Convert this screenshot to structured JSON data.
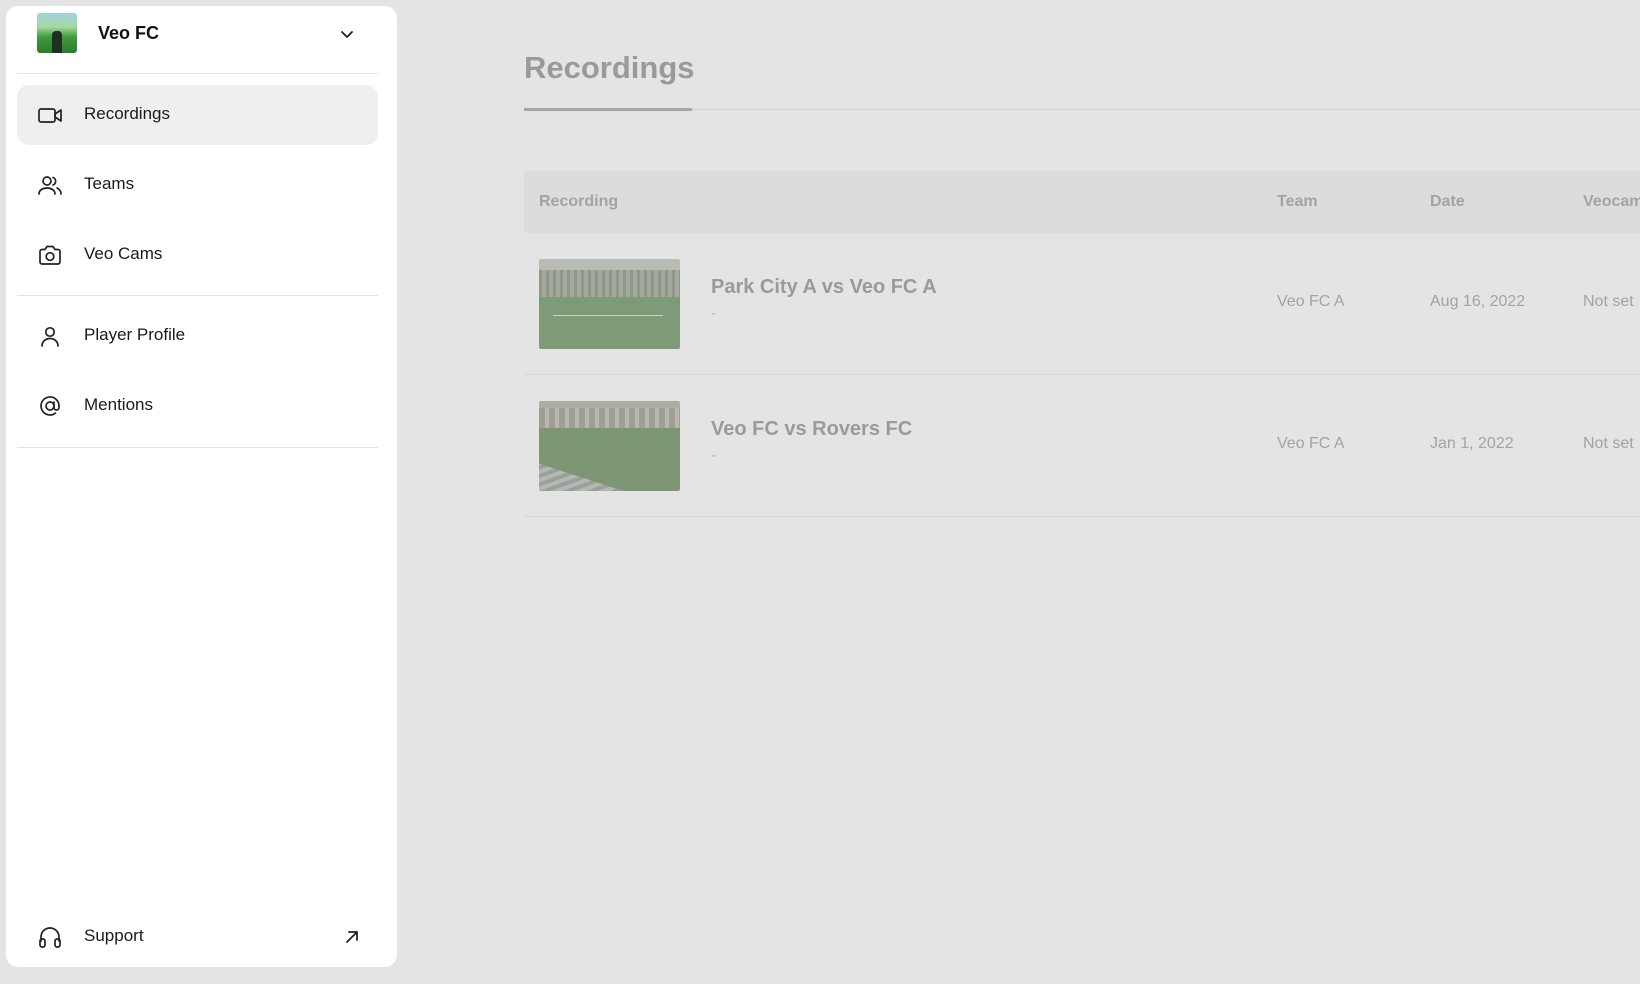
{
  "sidebar": {
    "club_name": "Veo FC",
    "nav": [
      {
        "label": "Recordings",
        "icon": "video-camera-icon",
        "active": true
      },
      {
        "label": "Teams",
        "icon": "users-icon",
        "active": false
      },
      {
        "label": "Veo Cams",
        "icon": "camera-icon",
        "active": false
      },
      {
        "label": "Player Profile",
        "icon": "user-icon",
        "active": false
      },
      {
        "label": "Mentions",
        "icon": "at-sign-icon",
        "active": false
      }
    ],
    "support_label": "Support"
  },
  "main": {
    "title": "Recordings",
    "table": {
      "headers": {
        "recording": "Recording",
        "team": "Team",
        "date": "Date",
        "veocam": "Veocam"
      },
      "rows": [
        {
          "title": "Park City A vs Veo FC A",
          "subtitle": "-",
          "team": "Veo FC A",
          "date": "Aug 16, 2022",
          "veocam": "Not set"
        },
        {
          "title": "Veo FC vs Rovers FC",
          "subtitle": "-",
          "team": "Veo FC A",
          "date": "Jan 1, 2022",
          "veocam": "Not set"
        }
      ]
    }
  },
  "colors": {
    "overlay_bg": "#e4e4e4",
    "sidebar_bg": "#ffffff",
    "active_item_bg": "#efefef"
  }
}
